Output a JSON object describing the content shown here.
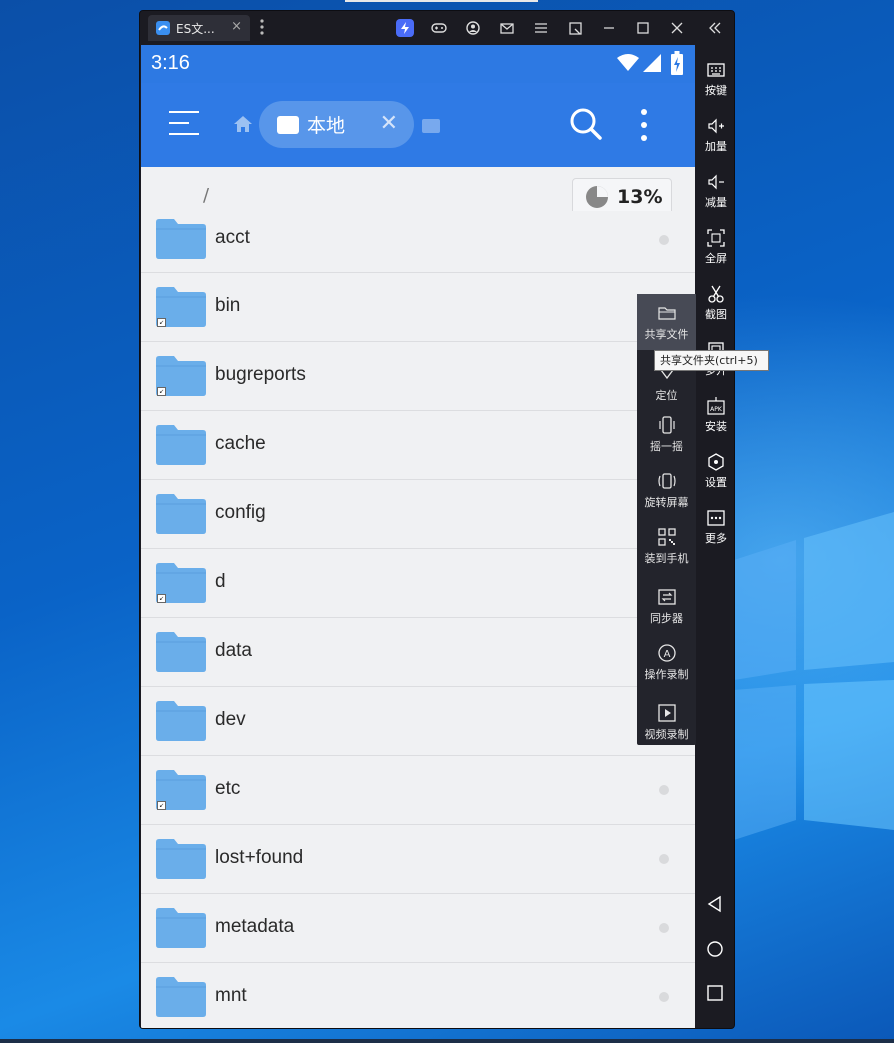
{
  "window": {
    "tab_title": "ES文...",
    "tab_close": "×"
  },
  "status": {
    "time": "3:16"
  },
  "appbar": {
    "location_chip": "本地",
    "chip_close": "✕"
  },
  "path": {
    "current": "/",
    "storage_usage": "13%"
  },
  "files": [
    {
      "name": "acct",
      "link": false
    },
    {
      "name": "bin",
      "link": true
    },
    {
      "name": "bugreports",
      "link": true
    },
    {
      "name": "cache",
      "link": false
    },
    {
      "name": "config",
      "link": false
    },
    {
      "name": "d",
      "link": true
    },
    {
      "name": "data",
      "link": false
    },
    {
      "name": "dev",
      "link": false
    },
    {
      "name": "etc",
      "link": true
    },
    {
      "name": "lost+found",
      "link": false
    },
    {
      "name": "metadata",
      "link": false
    },
    {
      "name": "mnt",
      "link": false
    }
  ],
  "sidebar": {
    "keys": "按键",
    "vol_up": "加量",
    "vol_down": "减量",
    "fullscreen": "全屏",
    "screenshot": "截图",
    "multi": "多开",
    "install": "安装",
    "settings": "设置",
    "more": "更多"
  },
  "floating": {
    "share_files": "共享文件",
    "locate": "定位",
    "shake": "摇一摇",
    "rotate": "旋转屏幕",
    "install_phone": "装到手机",
    "sync": "同步器",
    "macro": "操作录制",
    "video": "视频录制"
  },
  "tooltip": "共享文件夹(ctrl+5)",
  "colors": {
    "appbar": "#2f7ae5",
    "folder": "#6aaeea",
    "emulator_frame": "#1b1b22"
  }
}
